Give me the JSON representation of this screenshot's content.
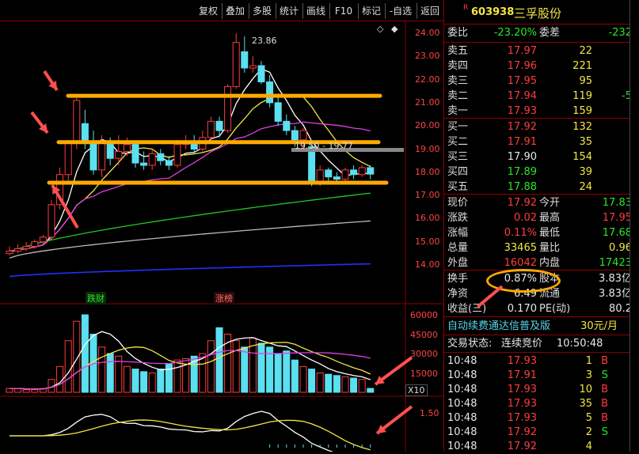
{
  "toolbar": {
    "buttons": [
      "复权",
      "叠加",
      "多股",
      "统计",
      "画线",
      "F10",
      "标记",
      "-自选",
      "返回"
    ]
  },
  "stock": {
    "badge": "R",
    "code": "603938",
    "name": "三孚股份"
  },
  "ratio": {
    "wb_label": "委比",
    "wb_value": "-23.20%",
    "wc_label": "委差",
    "wc_value": "-232"
  },
  "asks": [
    {
      "label": "卖五",
      "price": "17.97",
      "vol": "22",
      "chg": ""
    },
    {
      "label": "卖四",
      "price": "17.96",
      "vol": "221",
      "chg": ""
    },
    {
      "label": "卖三",
      "price": "17.95",
      "vol": "95",
      "chg": ""
    },
    {
      "label": "卖二",
      "price": "17.94",
      "vol": "119",
      "chg": "-5"
    },
    {
      "label": "卖一",
      "price": "17.93",
      "vol": "159",
      "chg": ""
    }
  ],
  "bids": [
    {
      "label": "买一",
      "price": "17.92",
      "vol": "132",
      "pc": "red"
    },
    {
      "label": "买二",
      "price": "17.91",
      "vol": "35",
      "pc": "red"
    },
    {
      "label": "买三",
      "price": "17.90",
      "vol": "154",
      "pc": "wht"
    },
    {
      "label": "买四",
      "price": "17.89",
      "vol": "39",
      "pc": "grn"
    },
    {
      "label": "买五",
      "price": "17.88",
      "vol": "24",
      "pc": "grn"
    }
  ],
  "quote": [
    {
      "l1": "现价",
      "v1": "17.92",
      "c1": "red",
      "l2": "今开",
      "v2": "17.83",
      "c2": "grn"
    },
    {
      "l1": "涨跌",
      "v1": "0.02",
      "c1": "red",
      "l2": "最高",
      "v2": "17.95",
      "c2": "red"
    },
    {
      "l1": "涨幅",
      "v1": "0.11%",
      "c1": "red",
      "l2": "最低",
      "v2": "17.68",
      "c2": "grn"
    },
    {
      "l1": "总量",
      "v1": "33465",
      "c1": "yel",
      "l2": "量比",
      "v2": "0.96",
      "c2": "yel"
    },
    {
      "l1": "外盘",
      "v1": "16042",
      "c1": "red",
      "l2": "内盘",
      "v2": "17423",
      "c2": "grn"
    }
  ],
  "fund": [
    {
      "l1": "换手",
      "v1": "0.87%",
      "l2": "股本",
      "v2": "3.83亿"
    },
    {
      "l1": "净资",
      "v1": "6.49",
      "l2": "流通",
      "v2": "3.83亿"
    },
    {
      "l1": "收益(三)",
      "v1": "0.170",
      "l2": "PE(动)",
      "v2": "80.2"
    }
  ],
  "promo": {
    "text": "自动续费通达信普及版",
    "price": "30元/月"
  },
  "trade_status": {
    "label": "交易状态:",
    "value": "连续竞价",
    "time": "10:50:48"
  },
  "ticks": [
    {
      "t": "10:48",
      "p": "17.93",
      "v": "1",
      "s": "B"
    },
    {
      "t": "10:48",
      "p": "17.91",
      "v": "3",
      "s": "S"
    },
    {
      "t": "10:48",
      "p": "17.93",
      "v": "10",
      "s": "B"
    },
    {
      "t": "10:48",
      "p": "17.93",
      "v": "35",
      "s": "B"
    },
    {
      "t": "10:48",
      "p": "17.93",
      "v": "5",
      "s": "B"
    },
    {
      "t": "10:48",
      "p": "17.92",
      "v": "2",
      "s": "S"
    },
    {
      "t": "10:48",
      "p": "17.92",
      "v": "4",
      "s": ""
    }
  ],
  "chart": {
    "price_axis": [
      "24.00",
      "23.00",
      "22.00",
      "21.00",
      "20.00",
      "19.00",
      "18.00",
      "17.00",
      "16.00",
      "15.00",
      "14.00"
    ],
    "vol_axis": [
      "60000",
      "45000",
      "30000",
      "15000"
    ],
    "vol_unit": "X10",
    "macd_axis": [
      "1.50"
    ],
    "peak_label": "23.86",
    "range_label": "19.50 - 19.77",
    "tag1": "跌财",
    "tag2": "涨榜"
  },
  "chart_data": {
    "type": "candlestick",
    "candles": [
      {
        "o": 14.5,
        "c": 14.6,
        "h": 14.8,
        "l": 14.4
      },
      {
        "o": 14.6,
        "c": 14.7,
        "h": 14.9,
        "l": 14.5
      },
      {
        "o": 14.7,
        "c": 14.8,
        "h": 15.0,
        "l": 14.6
      },
      {
        "o": 14.8,
        "c": 15.0,
        "h": 15.1,
        "l": 14.7
      },
      {
        "o": 15.0,
        "c": 15.2,
        "h": 15.3,
        "l": 14.9
      },
      {
        "o": 15.2,
        "c": 16.6,
        "h": 16.8,
        "l": 15.1
      },
      {
        "o": 16.6,
        "c": 17.9,
        "h": 18.2,
        "l": 16.4
      },
      {
        "o": 17.9,
        "c": 19.3,
        "h": 19.4,
        "l": 17.6
      },
      {
        "o": 19.3,
        "c": 21.1,
        "h": 21.2,
        "l": 19.0
      },
      {
        "o": 20.1,
        "c": 19.3,
        "h": 20.7,
        "l": 19.0
      },
      {
        "o": 19.3,
        "c": 18.1,
        "h": 19.8,
        "l": 17.9
      },
      {
        "o": 18.1,
        "c": 19.3,
        "h": 19.6,
        "l": 17.8
      },
      {
        "o": 19.3,
        "c": 18.6,
        "h": 19.5,
        "l": 18.3
      },
      {
        "o": 18.6,
        "c": 18.9,
        "h": 19.6,
        "l": 18.3
      },
      {
        "o": 18.9,
        "c": 19.2,
        "h": 19.5,
        "l": 18.7
      },
      {
        "o": 19.2,
        "c": 18.4,
        "h": 19.3,
        "l": 18.2
      },
      {
        "o": 18.4,
        "c": 18.3,
        "h": 18.9,
        "l": 18.1
      },
      {
        "o": 18.3,
        "c": 18.8,
        "h": 19.0,
        "l": 18.1
      },
      {
        "o": 18.8,
        "c": 18.5,
        "h": 19.0,
        "l": 18.3
      },
      {
        "o": 18.5,
        "c": 18.3,
        "h": 18.7,
        "l": 18.1
      },
      {
        "o": 18.3,
        "c": 19.2,
        "h": 19.4,
        "l": 18.2
      },
      {
        "o": 19.2,
        "c": 19.3,
        "h": 19.6,
        "l": 19.0
      },
      {
        "o": 19.3,
        "c": 19.0,
        "h": 19.6,
        "l": 18.8
      },
      {
        "o": 19.0,
        "c": 19.5,
        "h": 19.8,
        "l": 18.9
      },
      {
        "o": 19.5,
        "c": 20.2,
        "h": 20.4,
        "l": 19.4
      },
      {
        "o": 20.2,
        "c": 19.8,
        "h": 20.4,
        "l": 19.5
      },
      {
        "o": 19.8,
        "c": 21.7,
        "h": 21.8,
        "l": 19.7
      },
      {
        "o": 21.7,
        "c": 23.6,
        "h": 24.0,
        "l": 21.6
      },
      {
        "o": 23.2,
        "c": 22.5,
        "h": 23.86,
        "l": 22.3
      },
      {
        "o": 22.5,
        "c": 22.6,
        "h": 23.0,
        "l": 22.3
      },
      {
        "o": 22.6,
        "c": 21.9,
        "h": 22.8,
        "l": 21.8
      },
      {
        "o": 21.9,
        "c": 21.0,
        "h": 22.2,
        "l": 20.8
      },
      {
        "o": 21.0,
        "c": 20.2,
        "h": 21.4,
        "l": 20.0
      },
      {
        "o": 20.2,
        "c": 19.8,
        "h": 20.5,
        "l": 19.6
      },
      {
        "o": 19.8,
        "c": 19.4,
        "h": 20.0,
        "l": 19.1
      },
      {
        "o": 19.4,
        "c": 19.8,
        "h": 19.9,
        "l": 19.0
      },
      {
        "o": 19.1,
        "c": 17.5,
        "h": 19.2,
        "l": 17.4
      },
      {
        "o": 17.5,
        "c": 18.1,
        "h": 18.3,
        "l": 17.4
      },
      {
        "o": 18.1,
        "c": 17.8,
        "h": 18.2,
        "l": 17.6
      },
      {
        "o": 17.8,
        "c": 17.7,
        "h": 18.0,
        "l": 17.5
      },
      {
        "o": 17.7,
        "c": 18.1,
        "h": 18.2,
        "l": 17.6
      },
      {
        "o": 18.1,
        "c": 17.9,
        "h": 18.3,
        "l": 17.7
      },
      {
        "o": 17.9,
        "c": 18.2,
        "h": 18.3,
        "l": 17.8
      },
      {
        "o": 18.2,
        "c": 17.92,
        "h": 18.3,
        "l": 17.7
      }
    ],
    "levels": [
      21.3,
      19.3,
      17.55
    ],
    "volumes": [
      3,
      3,
      2,
      2,
      3,
      10,
      20,
      40,
      55,
      60,
      45,
      35,
      30,
      28,
      20,
      18,
      16,
      15,
      18,
      22,
      25,
      26,
      28,
      30,
      40,
      50,
      45,
      40,
      35,
      42,
      38,
      35,
      30,
      32,
      25,
      20,
      18,
      15,
      14,
      13,
      12,
      11,
      10,
      3
    ]
  }
}
